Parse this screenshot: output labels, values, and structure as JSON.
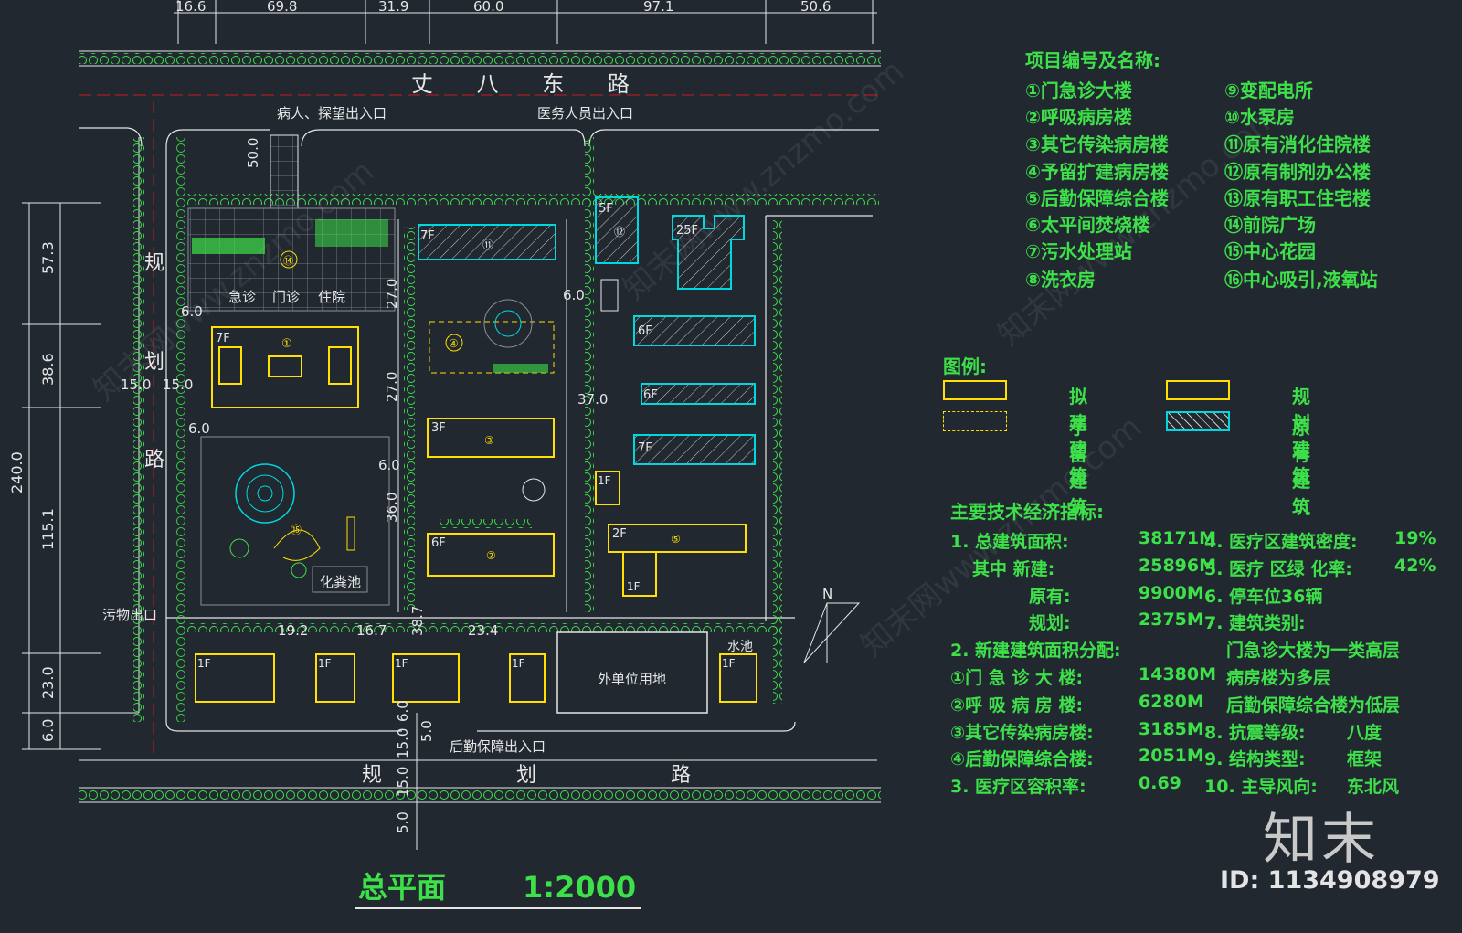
{
  "dimensions_top": [
    "16.6",
    "69.8",
    "31.9",
    "60.0",
    "97.1",
    "50.6"
  ],
  "roads": {
    "north": "丈 八 东 路",
    "west": [
      "规",
      "划",
      "路"
    ],
    "south": "规 划 路"
  },
  "entrances": {
    "patient": "病人、探望出入口",
    "medical": "医务人员出入口",
    "waste": "污物出口",
    "logistics": "后勤保障出入口"
  },
  "plaza_labels": [
    "急诊",
    "门诊",
    "住院"
  ],
  "site_labels": {
    "septic": "化粪池",
    "external": "外单位用地",
    "pool": "水池"
  },
  "dims": {
    "left_total": "240.0",
    "left_parts": [
      "57.3",
      "38.6",
      "115.1",
      "23.0",
      "6.0"
    ],
    "misc": [
      "50.0",
      "6.0",
      "15.0",
      "15.0",
      "6.0",
      "27.0",
      "27.0",
      "6.0",
      "37.0",
      "6.0",
      "36.0",
      "19.2",
      "16.7",
      "38.7",
      "23.4",
      "6.0",
      "5.0",
      "15.0",
      "15.0",
      "5.0"
    ]
  },
  "floors": [
    "7F",
    "7F",
    "5F",
    "25F",
    "6F",
    "6F",
    "7F",
    "3F",
    "6F",
    "1F",
    "2F",
    "1F",
    "1F",
    "1F",
    "1F",
    "1F",
    "1F"
  ],
  "project": {
    "title": "项目编号及名称:",
    "left": [
      "①门急诊大楼",
      "②呼吸病房楼",
      "③其它传染病房楼",
      "④予留扩建病房楼",
      "⑤后勤保障综合楼",
      "⑥太平间焚烧楼",
      "⑦污水处理站",
      "⑧洗衣房"
    ],
    "right": [
      "⑨变配电所",
      "⑩水泵房",
      "⑪原有消化住院楼",
      "⑫原有制剂办公楼",
      "⑬原有职工住宅楼",
      "⑭前院广场",
      "⑮中心花园",
      "⑯中心吸引,液氧站"
    ]
  },
  "legend": {
    "title": "图例:",
    "proposed": "拟建建筑",
    "reserved": "予留建筑",
    "planned": "规划建筑",
    "existing": "原有建筑"
  },
  "tech": {
    "title": "主要技术经济指标:",
    "rows": [
      [
        "1. 总建筑面积:",
        "38171M",
        "4. 医疗区建筑密度:",
        "19%"
      ],
      [
        "其中  新建:",
        "25896M",
        "5. 医疗 区绿 化率:",
        "42%"
      ],
      [
        "原有:",
        "9900M",
        "6. 停车位36辆",
        ""
      ],
      [
        "规划:",
        "2375M",
        "7. 建筑类别:",
        ""
      ],
      [
        "2. 新建建筑面积分配:",
        "",
        "门急诊大楼为一类高层",
        ""
      ],
      [
        "①门 急 诊 大 楼:",
        "14380M",
        "病房楼为多层",
        ""
      ],
      [
        "②呼 吸 病 房 楼:",
        "6280M",
        "后勤保障综合楼为低层",
        ""
      ],
      [
        "③其它传染病房楼:",
        "3185M",
        "8. 抗震等级:",
        "八度"
      ],
      [
        "④后勤保障综合楼:",
        "2051M",
        "9. 结构类型:",
        "框架"
      ],
      [
        "3. 医疗区容积率:",
        "0.69",
        "10. 主导风向:",
        "东北风"
      ]
    ]
  },
  "plan_title": "总平面",
  "scale": "1:2000",
  "compass": "N",
  "watermark": "知末网www.znzmo.com",
  "brand": "知末",
  "brand_id": "ID: 1134908979",
  "colors": {
    "background": "#212830",
    "label_green": "#3ee04a",
    "new_building_yellow": "#ffe000",
    "existing_cyan": "#00d8e0",
    "magenta": "#ff2fff",
    "red_line": "#d01820"
  }
}
